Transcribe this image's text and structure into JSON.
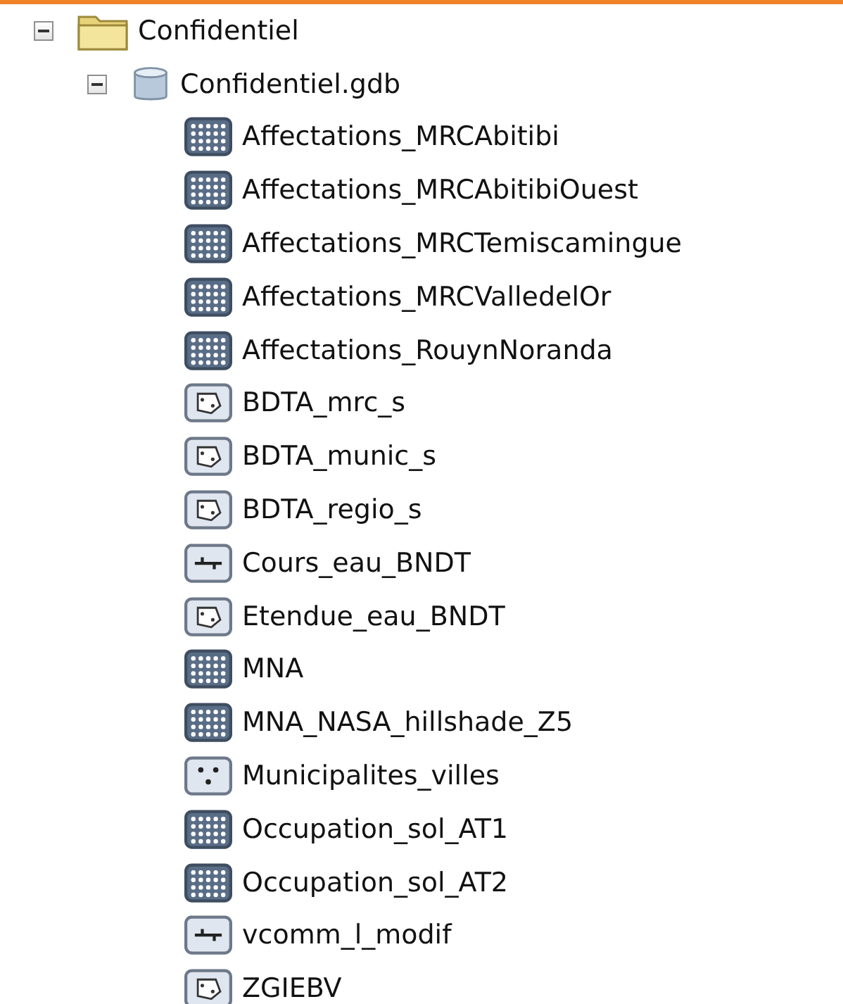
{
  "tree": [
    {
      "label": "Confidentiel",
      "kind": "folder",
      "expanded": true,
      "children": [
        {
          "label": "Confidentiel.gdb",
          "kind": "geodatabase",
          "expanded": true,
          "children": [
            {
              "label": "Affectations_MRCAbitibi",
              "kind": "raster"
            },
            {
              "label": "Affectations_MRCAbitibiOuest",
              "kind": "raster"
            },
            {
              "label": "Affectations_MRCTemiscamingue",
              "kind": "raster"
            },
            {
              "label": "Affectations_MRCValledelOr",
              "kind": "raster"
            },
            {
              "label": "Affectations_RouynNoranda",
              "kind": "raster"
            },
            {
              "label": "BDTA_mrc_s",
              "kind": "polygon"
            },
            {
              "label": "BDTA_munic_s",
              "kind": "polygon"
            },
            {
              "label": "BDTA_regio_s",
              "kind": "polygon"
            },
            {
              "label": "Cours_eau_BNDT",
              "kind": "line"
            },
            {
              "label": "Etendue_eau_BNDT",
              "kind": "polygon"
            },
            {
              "label": "MNA",
              "kind": "raster"
            },
            {
              "label": "MNA_NASA_hillshade_Z5",
              "kind": "raster"
            },
            {
              "label": "Municipalites_villes",
              "kind": "point"
            },
            {
              "label": "Occupation_sol_AT1",
              "kind": "raster"
            },
            {
              "label": "Occupation_sol_AT2",
              "kind": "raster"
            },
            {
              "label": "vcomm_l_modif",
              "kind": "line"
            },
            {
              "label": "ZGIEBV",
              "kind": "polygon"
            }
          ]
        }
      ]
    }
  ]
}
